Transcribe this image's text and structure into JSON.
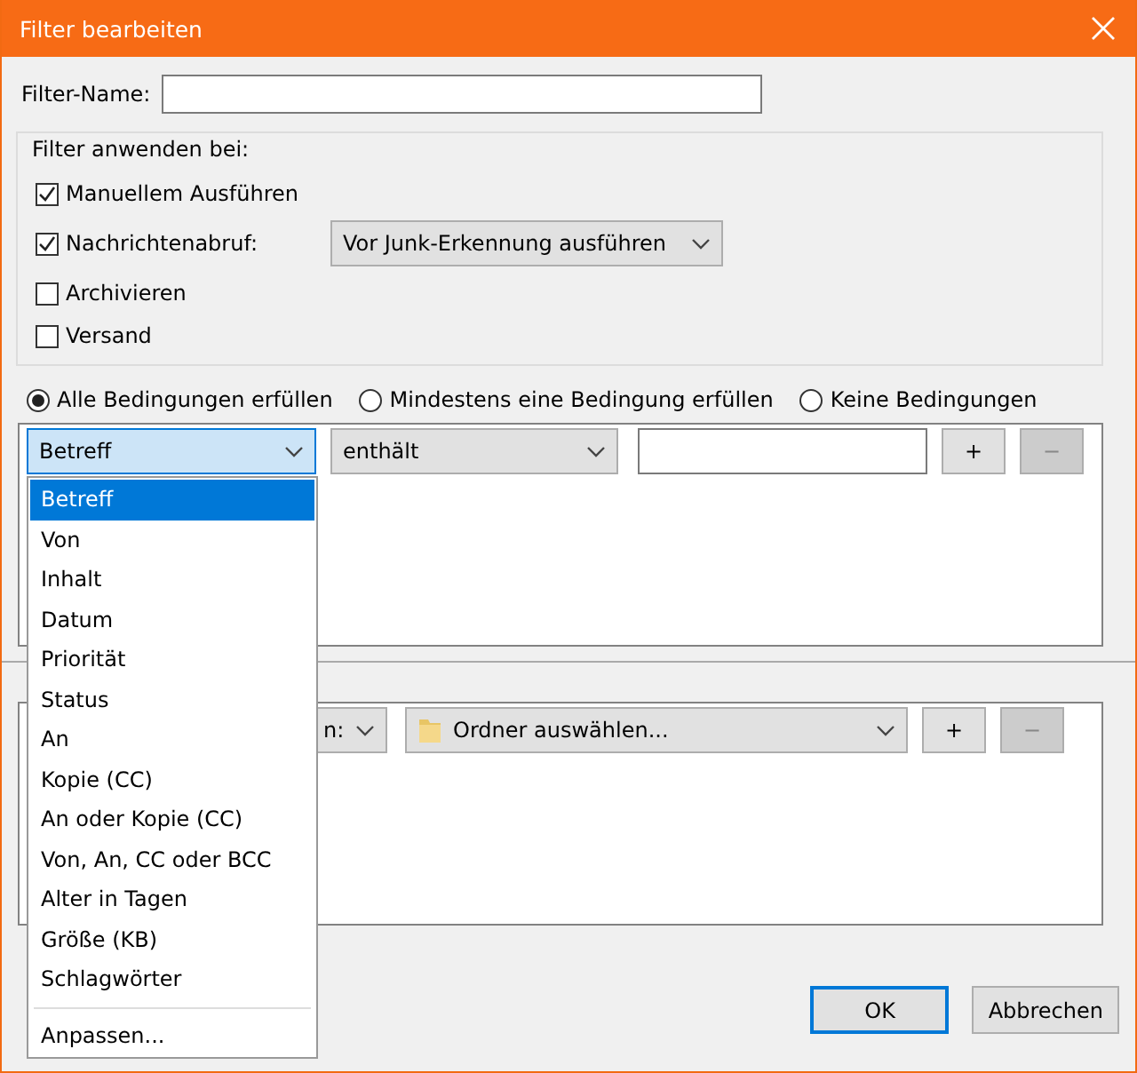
{
  "window": {
    "title": "Filter bearbeiten"
  },
  "filter_name": {
    "label": "Filter-Name:"
  },
  "apply_group": {
    "legend": "Filter anwenden bei:",
    "options": [
      {
        "kind": "checkbox",
        "label": "Manuellem Ausführen",
        "checked": true
      },
      {
        "kind": "checkbox_select",
        "label": "Nachrichtenabruf:",
        "checked": true,
        "select": "Vor Junk-Erkennung ausführen"
      },
      {
        "kind": "checkbox",
        "label": "Archivieren",
        "checked": false
      },
      {
        "kind": "checkbox",
        "label": "Versand",
        "checked": false
      }
    ]
  },
  "match": [
    {
      "label": "Alle Bedingungen erfüllen",
      "selected": true
    },
    {
      "label": "Mindestens eine Bedingung erfüllen",
      "selected": false
    },
    {
      "label": "Keine Bedingungen",
      "selected": false
    }
  ],
  "condition": {
    "field": "Betreff",
    "operator": "enthält",
    "add": "+",
    "remove": "−",
    "remove_disabled": true
  },
  "action": {
    "type": "n:",
    "folder": "Ordner auswählen...",
    "add": "+",
    "remove": "−",
    "remove_disabled": true
  },
  "field_menu": {
    "items": [
      {
        "label": "Betreff",
        "selected": true
      },
      {
        "label": "Von",
        "selected": false
      },
      {
        "label": "Inhalt",
        "selected": false
      },
      {
        "label": "Datum",
        "selected": false
      },
      {
        "label": "Priorität",
        "selected": false
      },
      {
        "label": "Status",
        "selected": false
      },
      {
        "label": "An",
        "selected": false
      },
      {
        "label": "Kopie (CC)",
        "selected": false
      },
      {
        "label": "An oder Kopie (CC)",
        "selected": false
      },
      {
        "label": "Von, An, CC oder BCC",
        "selected": false
      },
      {
        "label": "Alter in Tagen",
        "selected": false
      },
      {
        "label": "Größe (KB)",
        "selected": false
      },
      {
        "label": "Schlagwörter",
        "selected": false
      }
    ],
    "footer": "Anpassen..."
  },
  "buttons": [
    {
      "label": "OK",
      "default": true
    },
    {
      "label": "Abbrechen",
      "default": false
    }
  ]
}
